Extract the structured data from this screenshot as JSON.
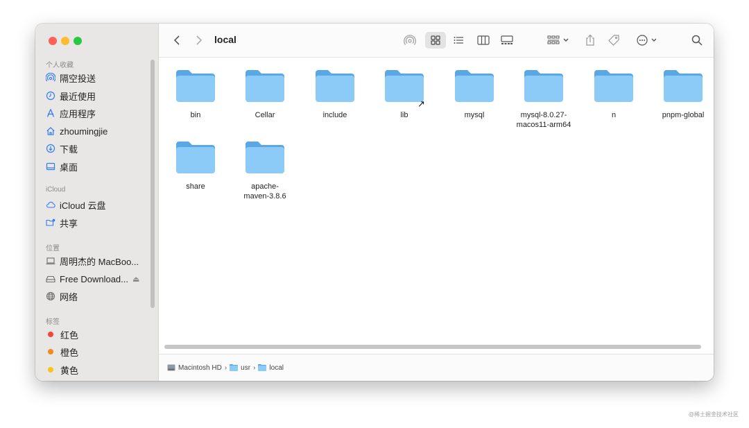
{
  "window": {
    "title": "local"
  },
  "sidebar": {
    "sections": [
      {
        "label": "个人收藏",
        "items": [
          {
            "label": "隔空投送",
            "icon": "airdrop-icon"
          },
          {
            "label": "最近使用",
            "icon": "clock-icon"
          },
          {
            "label": "应用程序",
            "icon": "applications-icon"
          },
          {
            "label": "zhoumingjie",
            "icon": "home-icon"
          },
          {
            "label": "下载",
            "icon": "download-icon"
          },
          {
            "label": "桌面",
            "icon": "desktop-icon"
          }
        ]
      },
      {
        "label": "iCloud",
        "items": [
          {
            "label": "iCloud 云盘",
            "icon": "cloud-icon"
          },
          {
            "label": "共享",
            "icon": "shared-folder-icon"
          }
        ]
      },
      {
        "label": "位置",
        "items": [
          {
            "label": "周明杰的 MacBoo...",
            "icon": "laptop-icon"
          },
          {
            "label": "Free Download...",
            "icon": "drive-icon"
          },
          {
            "label": "网络",
            "icon": "network-icon"
          }
        ]
      },
      {
        "label": "标签",
        "items": [
          {
            "label": "红色",
            "color": "#f0463c"
          },
          {
            "label": "橙色",
            "color": "#f28a1c"
          },
          {
            "label": "黄色",
            "color": "#f5c518"
          }
        ]
      }
    ]
  },
  "files": [
    {
      "name_lines": [
        "bin"
      ]
    },
    {
      "name_lines": [
        "Cellar"
      ]
    },
    {
      "name_lines": [
        "include"
      ]
    },
    {
      "name_lines": [
        "lib"
      ]
    },
    {
      "name_lines": [
        "mysql"
      ]
    },
    {
      "name_lines": [
        "mysql-8.0.27-",
        "macos11-arm64"
      ]
    },
    {
      "name_lines": [
        "n"
      ]
    },
    {
      "name_lines": [
        "pnpm-global"
      ]
    },
    {
      "name_lines": [
        "share"
      ]
    },
    {
      "name_lines": [
        "apache-",
        "maven-3.8.6"
      ]
    }
  ],
  "pathbar": [
    "Macintosh HD",
    "usr",
    "local"
  ],
  "pathbar_separator": "›",
  "watermark": "@稀土掘金技术社区",
  "colors": {
    "folder_body": "#8ccaf7",
    "folder_tab": "#5aa7e6",
    "accent": "#2f7cf6"
  }
}
